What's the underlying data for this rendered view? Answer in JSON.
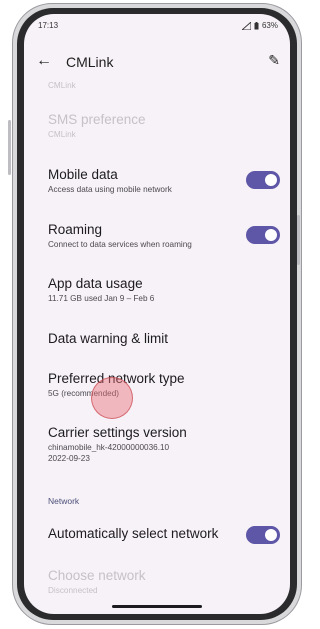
{
  "status": {
    "time": "17:13",
    "battery": "63%"
  },
  "appbar": {
    "back_icon": "arrow-back-icon",
    "title": "CMLink",
    "edit_icon": "pencil-icon"
  },
  "items": {
    "top_partial": {
      "subtitle": "CMLink"
    },
    "sms": {
      "title": "SMS preference",
      "subtitle": "CMLink"
    },
    "mobile_data": {
      "title": "Mobile data",
      "subtitle": "Access data using mobile network",
      "enabled": true
    },
    "roaming": {
      "title": "Roaming",
      "subtitle": "Connect to data services when roaming",
      "enabled": true
    },
    "app_data": {
      "title": "App data usage",
      "subtitle": "11.71 GB used Jan 9 – Feb 6"
    },
    "data_warning": {
      "title": "Data warning & limit"
    },
    "network_type": {
      "title": "Preferred network type",
      "subtitle": "5G (recommended)"
    },
    "carrier": {
      "title": "Carrier settings version",
      "subtitle": "chinamobile_hk-42000000036.10",
      "subtitle2": "2022-09-23"
    },
    "section_network": {
      "label": "Network"
    },
    "auto_network": {
      "title": "Automatically select network",
      "enabled": true
    },
    "choose_network": {
      "title": "Choose network",
      "subtitle": "Disconnected"
    }
  },
  "colors": {
    "toggle_on": "#5e56a6",
    "background": "#f7f2f7",
    "touch_indicator": "#e86e78"
  }
}
